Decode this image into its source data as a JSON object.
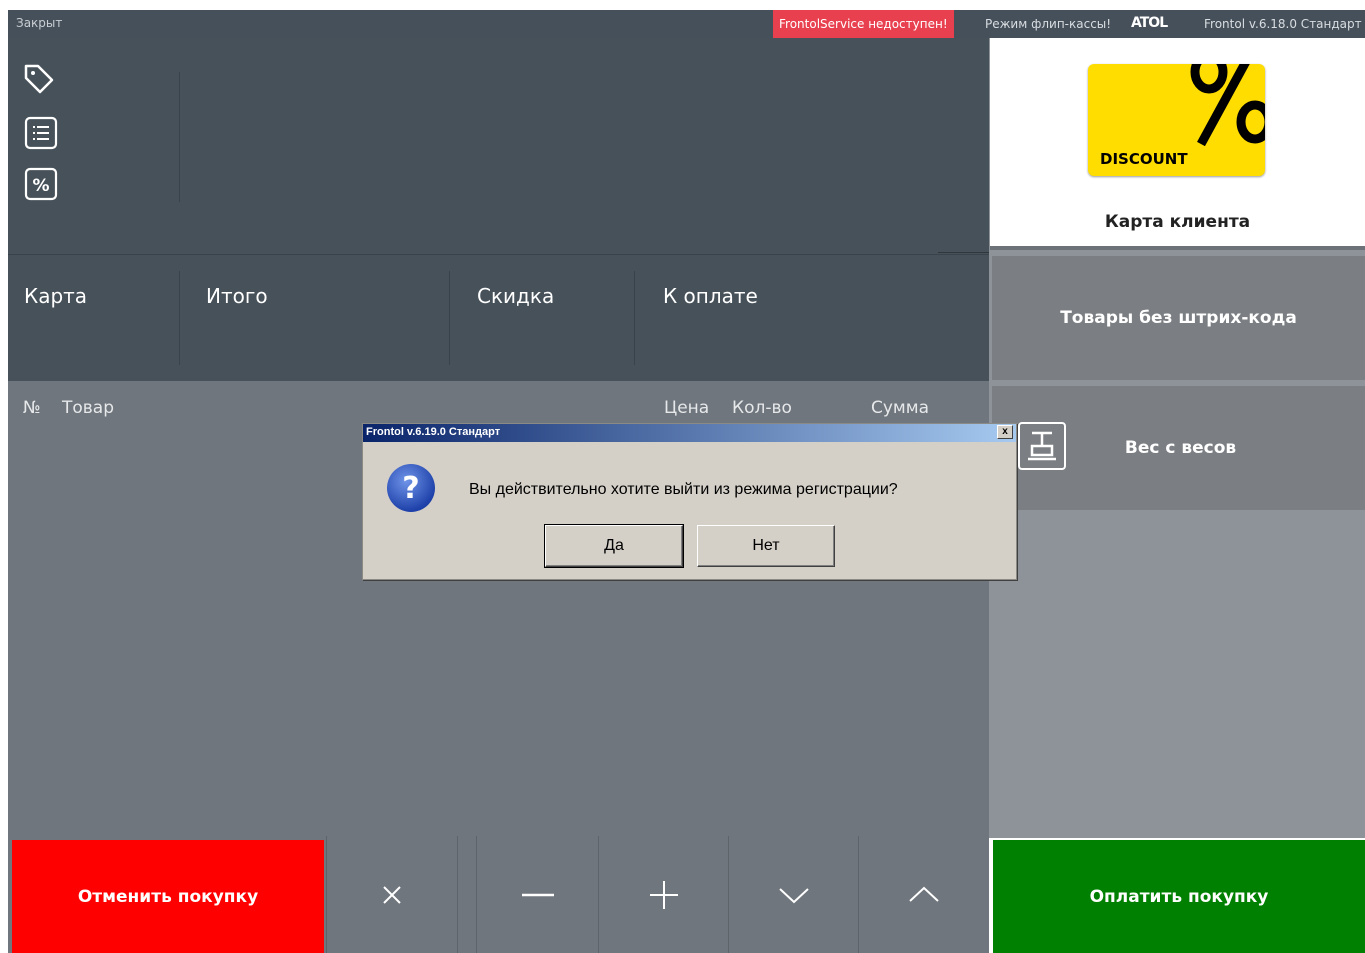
{
  "topbar": {
    "status": "Закрыт",
    "service_warning": "FrontolService недоступен!",
    "flip_mode": "Режим флип-кассы!",
    "brand_logo": "ATOL",
    "version": "Frontol v.6.18.0 Стандарт"
  },
  "info_panel": {
    "icons": [
      "tag-icon",
      "list-icon",
      "percent-icon"
    ]
  },
  "totals": {
    "card_label": "Карта",
    "total_label": "Итого",
    "discount_label": "Скидка",
    "to_pay_label": "К оплате"
  },
  "table": {
    "columns": {
      "number": "№",
      "product": "Товар",
      "price": "Цена",
      "qty": "Кол-во",
      "sum": "Сумма"
    }
  },
  "right_panel": {
    "discount_card_text": "DISCOUNT",
    "client_card_label": "Карта клиента",
    "no_barcode_label": "Товары без штрих-кода",
    "scale_label": "Вес с весов"
  },
  "bottom": {
    "cancel_label": "Отменить покупку",
    "pay_label": "Оплатить покупку",
    "controls": [
      "delete-icon",
      "minus-icon",
      "plus-icon",
      "chevron-down-icon",
      "chevron-up-icon"
    ]
  },
  "dialog": {
    "title": "Frontol v.6.19.0 Стандарт",
    "close_glyph": "x",
    "message": "Вы действительно хотите выйти из режима регистрации?",
    "yes_label": "Да",
    "no_label": "Нет"
  },
  "colors": {
    "cancel": "#ff0000",
    "pay": "#008000",
    "warning": "#e8404f",
    "discount_card": "#ffdd00"
  }
}
